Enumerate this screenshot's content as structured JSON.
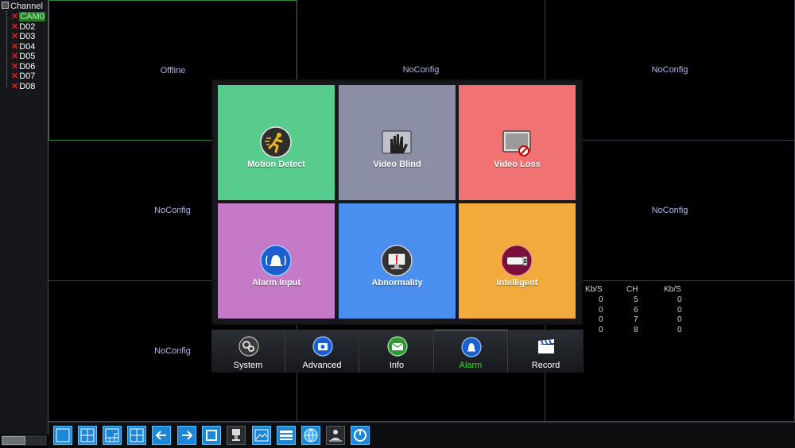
{
  "sidebar": {
    "title": "Channel",
    "items": [
      {
        "label": "CAM0",
        "selected": true
      },
      {
        "label": "D02",
        "selected": false
      },
      {
        "label": "D03",
        "selected": false
      },
      {
        "label": "D04",
        "selected": false
      },
      {
        "label": "D05",
        "selected": false
      },
      {
        "label": "D06",
        "selected": false
      },
      {
        "label": "D07",
        "selected": false
      },
      {
        "label": "D08",
        "selected": false
      }
    ],
    "status_icon": "red-x-icon"
  },
  "grid": {
    "cells": [
      {
        "status": "Offline",
        "active": true
      },
      {
        "status": "NoConfig",
        "active": false
      },
      {
        "status": "NoConfig",
        "active": false
      },
      {
        "status": "NoConfig",
        "active": false
      },
      {
        "status": "",
        "active": false
      },
      {
        "status": "NoConfig",
        "active": false
      },
      {
        "status": "NoConfig",
        "active": false
      },
      {
        "status": "",
        "active": false
      },
      {
        "status": "",
        "active": false
      }
    ]
  },
  "bitrate": {
    "headers": [
      "Kb/S",
      "CH",
      "Kb/S"
    ],
    "rows": [
      [
        "0",
        "5",
        "0"
      ],
      [
        "0",
        "6",
        "0"
      ],
      [
        "0",
        "7",
        "0"
      ],
      [
        "0",
        "8",
        "0"
      ]
    ]
  },
  "alarm_menu": {
    "tiles": [
      {
        "label": "Motion Detect",
        "color": "#58cc8c",
        "icon": "motion-detect-icon"
      },
      {
        "label": "Video Blind",
        "color": "#8a8fa6",
        "icon": "video-blind-icon"
      },
      {
        "label": "Video Loss",
        "color": "#f07272",
        "icon": "video-loss-icon"
      },
      {
        "label": "Alarm Input",
        "color": "#c57ac8",
        "icon": "alarm-input-icon"
      },
      {
        "label": "Abnormality",
        "color": "#4a8fef",
        "icon": "abnormality-icon"
      },
      {
        "label": "Intelligent",
        "color": "#f3aa3c",
        "icon": "intelligent-icon"
      }
    ]
  },
  "tabs": [
    {
      "label": "System",
      "icon": "gears-icon",
      "active": false
    },
    {
      "label": "Advanced",
      "icon": "advanced-icon",
      "active": false
    },
    {
      "label": "Info",
      "icon": "info-icon",
      "active": false
    },
    {
      "label": "Alarm",
      "icon": "alarm-bell-icon",
      "active": true
    },
    {
      "label": "Record",
      "icon": "clapper-icon",
      "active": false
    }
  ],
  "toolbar": {
    "buttons": [
      {
        "icon": "split-1-icon"
      },
      {
        "icon": "split-4-icon"
      },
      {
        "icon": "split-8-icon"
      },
      {
        "icon": "split-9-icon"
      },
      {
        "icon": "prev-arrow-icon"
      },
      {
        "icon": "next-arrow-icon"
      },
      {
        "icon": "tour-icon"
      },
      {
        "icon": "ptz-icon"
      },
      {
        "icon": "color-icon"
      },
      {
        "icon": "playback-icon"
      },
      {
        "icon": "network-icon"
      },
      {
        "icon": "user-icon"
      },
      {
        "icon": "logout-icon"
      }
    ]
  }
}
